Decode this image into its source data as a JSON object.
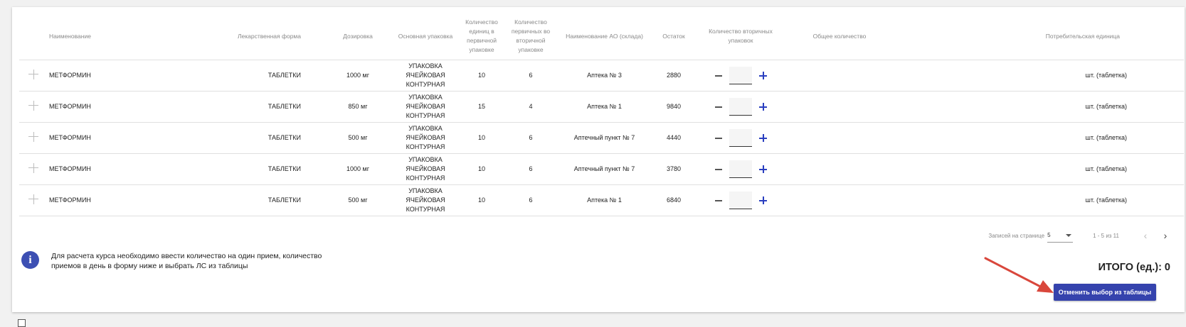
{
  "table": {
    "headers": {
      "name": "Наименование",
      "form": "Лекарственная форма",
      "dosage": "Дозировка",
      "package": "Основная упаковка",
      "units_primary": "Количество единиц в первичной упаковке",
      "primary_in_secondary": "Количество первичных во вторичной упаковке",
      "pharmacy": "Наименование АО (склада)",
      "remain": "Остаток",
      "secondary_count": "Количество вторичных упаковок",
      "total_count": "Общее количество",
      "consumer_unit": "Потребительская единица"
    },
    "rows": [
      {
        "name": "МЕТФОРМИН",
        "form": "ТАБЛЕТКИ",
        "dosage": "1000 мг",
        "package": "УПАКОВКА ЯЧЕЙКОВАЯ КОНТУРНАЯ",
        "units_primary": "10",
        "primary_in_secondary": "6",
        "pharmacy": "Аптека № 3",
        "remain": "2880",
        "qty": "",
        "total": "",
        "consumer_unit": "шт. (таблетка)"
      },
      {
        "name": "МЕТФОРМИН",
        "form": "ТАБЛЕТКИ",
        "dosage": "850 мг",
        "package": "УПАКОВКА ЯЧЕЙКОВАЯ КОНТУРНАЯ",
        "units_primary": "15",
        "primary_in_secondary": "4",
        "pharmacy": "Аптека № 1",
        "remain": "9840",
        "qty": "",
        "total": "",
        "consumer_unit": "шт. (таблетка)"
      },
      {
        "name": "МЕТФОРМИН",
        "form": "ТАБЛЕТКИ",
        "dosage": "500 мг",
        "package": "УПАКОВКА ЯЧЕЙКОВАЯ КОНТУРНАЯ",
        "units_primary": "10",
        "primary_in_secondary": "6",
        "pharmacy": "Аптечный пункт № 7",
        "remain": "4440",
        "qty": "",
        "total": "",
        "consumer_unit": "шт. (таблетка)"
      },
      {
        "name": "МЕТФОРМИН",
        "form": "ТАБЛЕТКИ",
        "dosage": "1000 мг",
        "package": "УПАКОВКА ЯЧЕЙКОВАЯ КОНТУРНАЯ",
        "units_primary": "10",
        "primary_in_secondary": "6",
        "pharmacy": "Аптечный пункт № 7",
        "remain": "3780",
        "qty": "",
        "total": "",
        "consumer_unit": "шт. (таблетка)"
      },
      {
        "name": "МЕТФОРМИН",
        "form": "ТАБЛЕТКИ",
        "dosage": "500 мг",
        "package": "УПАКОВКА ЯЧЕЙКОВАЯ КОНТУРНАЯ",
        "units_primary": "10",
        "primary_in_secondary": "6",
        "pharmacy": "Аптека № 1",
        "remain": "6840",
        "qty": "",
        "total": "",
        "consumer_unit": "шт. (таблетка)"
      }
    ]
  },
  "pagination": {
    "rows_label": "Записей на странице",
    "rows_value": "5",
    "range": "1 - 5 из 11",
    "prev_icon": "chevron-left-icon",
    "next_icon": "chevron-right-icon"
  },
  "info": {
    "icon": "info-icon",
    "text": "Для расчета курса необходимо ввести количество на один прием, количество приемов в день в форму ниже и выбрать ЛС из таблицы"
  },
  "total": {
    "label": "ИТОГО (ед.): 0"
  },
  "cancel_button": {
    "label": "Отменить выбор из таблицы"
  },
  "colors": {
    "accent": "#3543ad",
    "annotation_arrow": "#d9473c"
  }
}
